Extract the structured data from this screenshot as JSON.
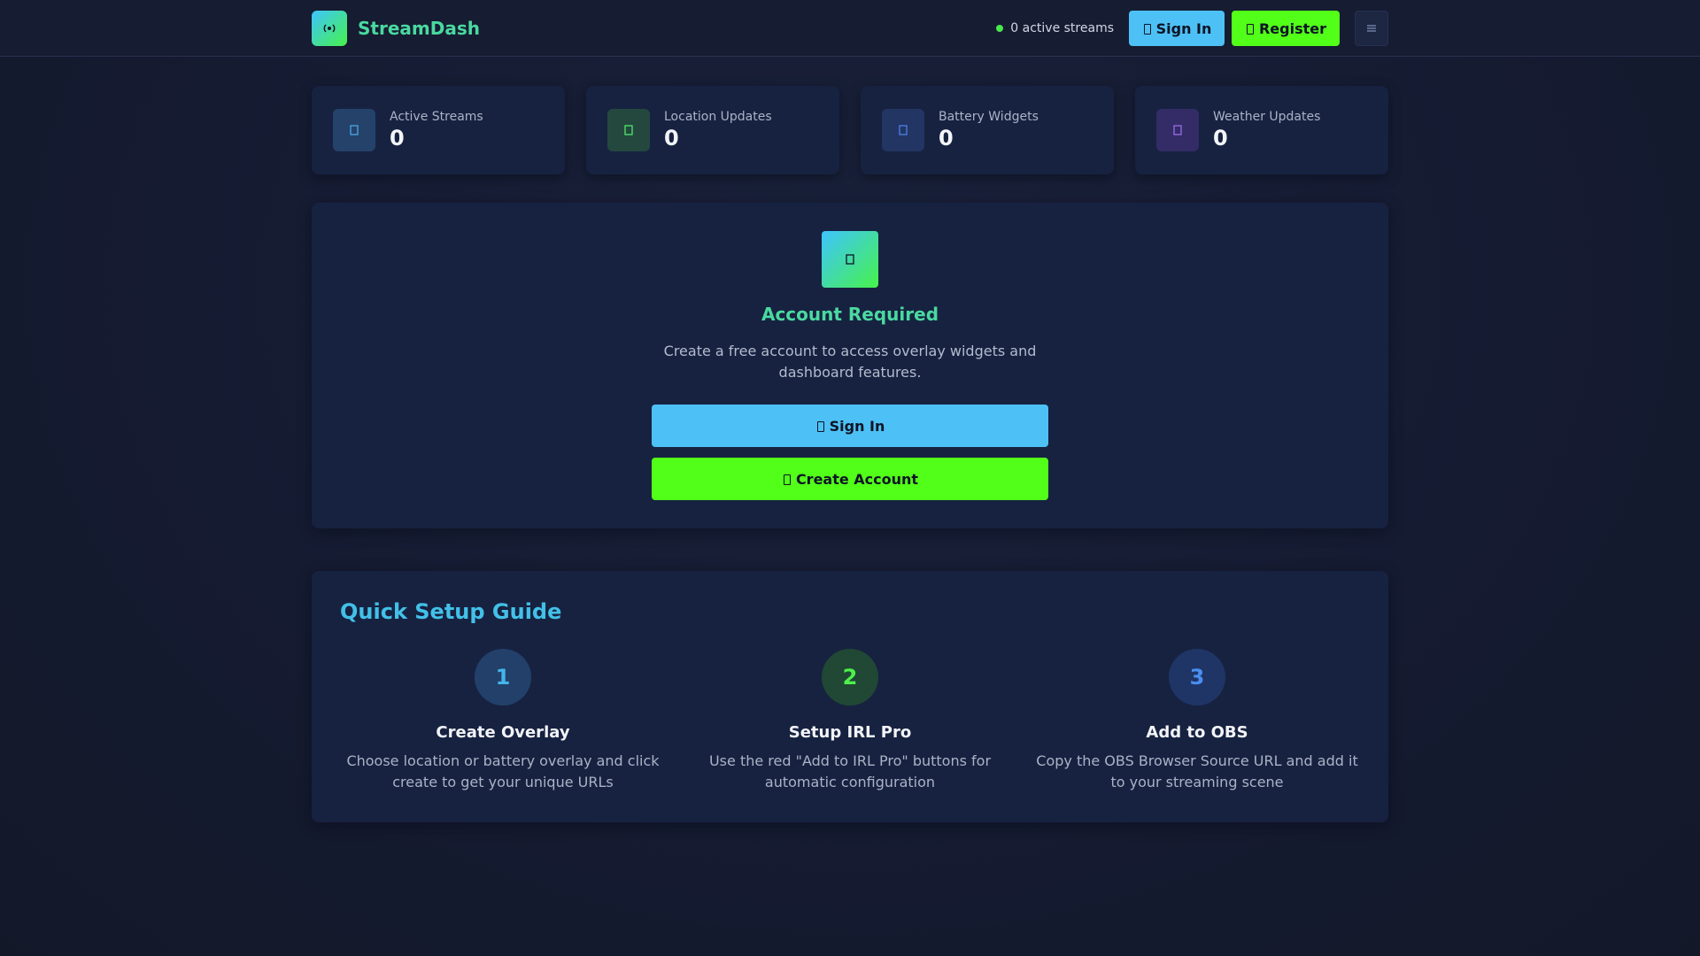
{
  "header": {
    "brand": "StreamDash",
    "brand_icon": "broadcast-icon",
    "status_text": "0 active streams",
    "sign_in_label": "Sign In",
    "register_label": "Register",
    "menu_icon": "menu-icon"
  },
  "stats": [
    {
      "label": "Active Streams",
      "value": "0",
      "icon": "video-icon",
      "color": "#4aa8e6"
    },
    {
      "label": "Location Updates",
      "value": "0",
      "icon": "map-pin-icon",
      "color": "#4ee86a"
    },
    {
      "label": "Battery Widgets",
      "value": "0",
      "icon": "battery-icon",
      "color": "#4d7fe8"
    },
    {
      "label": "Weather Updates",
      "value": "0",
      "icon": "cloud-icon",
      "color": "#9b6ee8"
    }
  ],
  "auth": {
    "title": "Account Required",
    "description": "Create a free account to access overlay widgets and dashboard features.",
    "sign_in_label": "Sign In",
    "create_label": "Create Account"
  },
  "guide": {
    "title": "Quick Setup Guide",
    "steps": [
      {
        "number": "1",
        "title": "Create Overlay",
        "description": "Choose location or battery overlay and click create to get your unique URLs",
        "color": "#43b5ea"
      },
      {
        "number": "2",
        "title": "Setup IRL Pro",
        "description": "Use the red \"Add to IRL Pro\" buttons for automatic configuration",
        "color": "#4ef04c"
      },
      {
        "number": "3",
        "title": "Add to OBS",
        "description": "Copy the OBS Browser Source URL and add it to your streaming scene",
        "color": "#4a8ef0"
      }
    ]
  },
  "colors": {
    "accent_blue": "#4dc1f5",
    "accent_green": "#52ff18",
    "brand_text": "#4ad9a0",
    "card_bg": "#172241"
  }
}
